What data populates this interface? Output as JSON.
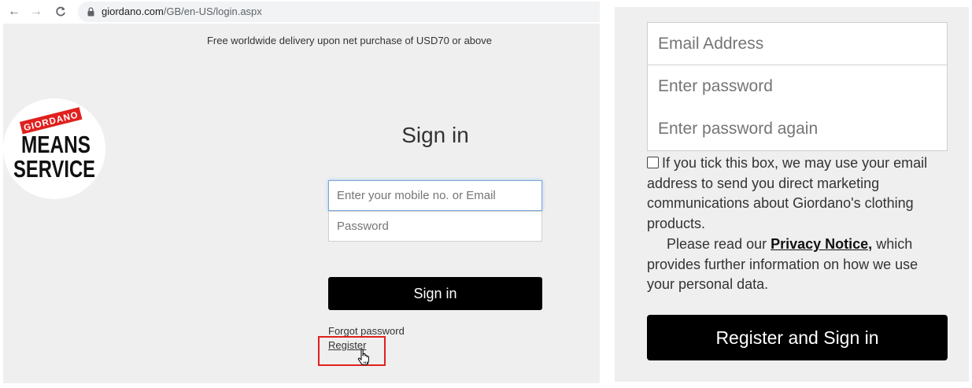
{
  "browser": {
    "url_host": "giordano.com",
    "url_path": "/GB/en-US/login.aspx",
    "back_icon": "←",
    "forward_icon": "→",
    "reload_icon": "C"
  },
  "banner": {
    "delivery_text": "Free worldwide delivery upon net purchase of USD70 or above"
  },
  "logo": {
    "brand": "GIORDANO",
    "line1": "MEANS",
    "line2": "SERVICE",
    "brand_color": "#e0201e"
  },
  "login": {
    "title": "Sign in",
    "mobile_placeholder": "Enter your mobile no. or Email",
    "password_placeholder": "Password",
    "signin_button": "Sign in",
    "forgot_password": "Forgot password",
    "register": "Register"
  },
  "register_form": {
    "email_placeholder": "Email Address",
    "password_placeholder": "Enter password",
    "password_again_placeholder": "Enter password again",
    "consent_text": "If you tick this box, we may use your email address to send you direct marketing communications about Giordano's clothing products.",
    "privacy_prefix": "Please read our ",
    "privacy_link": "Privacy Notice,",
    "privacy_suffix": " which provides further information on how we use your personal data.",
    "submit_button": "Register and Sign in"
  },
  "colors": {
    "accent_red": "#e0201e",
    "button_black": "#000000",
    "page_bg": "#efefef"
  }
}
